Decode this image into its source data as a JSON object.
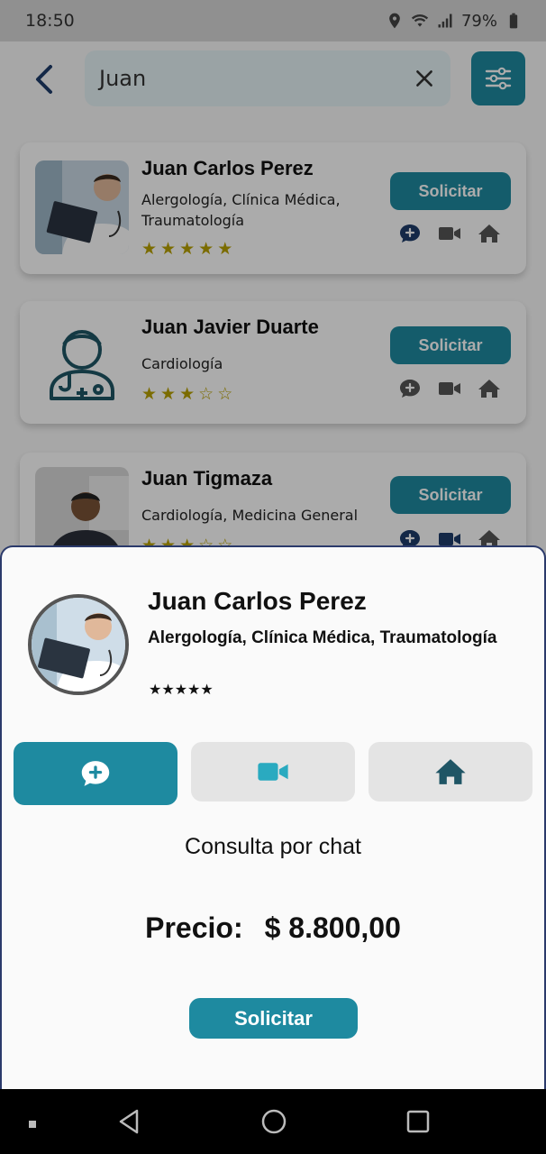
{
  "status_bar": {
    "time": "18:50",
    "battery": "79%"
  },
  "search": {
    "value": "Juan"
  },
  "doctors": [
    {
      "name": "Juan Carlos Perez",
      "specialties": "Alergología, Clínica Médica, Traumatología",
      "rating": 5,
      "button": "Solicitar"
    },
    {
      "name": "Juan Javier Duarte",
      "specialties": "Cardiología",
      "rating": 3,
      "button": "Solicitar"
    },
    {
      "name": "Juan Tigmaza",
      "specialties": "Cardiología, Medicina General",
      "rating": 3,
      "button": "Solicitar"
    }
  ],
  "sheet": {
    "name": "Juan Carlos Perez",
    "specialties": "Alergología, Clínica Médica, Traumatología",
    "rating": 5,
    "stars": "★★★★★",
    "tabs": [
      {
        "icon": "chat-plus-icon",
        "active": true
      },
      {
        "icon": "video-camera-icon",
        "active": false
      },
      {
        "icon": "home-icon",
        "active": false
      }
    ],
    "mode": "Consulta por chat",
    "price_label": "Precio:",
    "price_value": "$ 8.800,00",
    "button": "Solicitar"
  },
  "colors": {
    "accent": "#1e8aa0",
    "star": "#d8bd00",
    "muted_icon": "#555555",
    "navy_icon": "#1f3d6b"
  }
}
